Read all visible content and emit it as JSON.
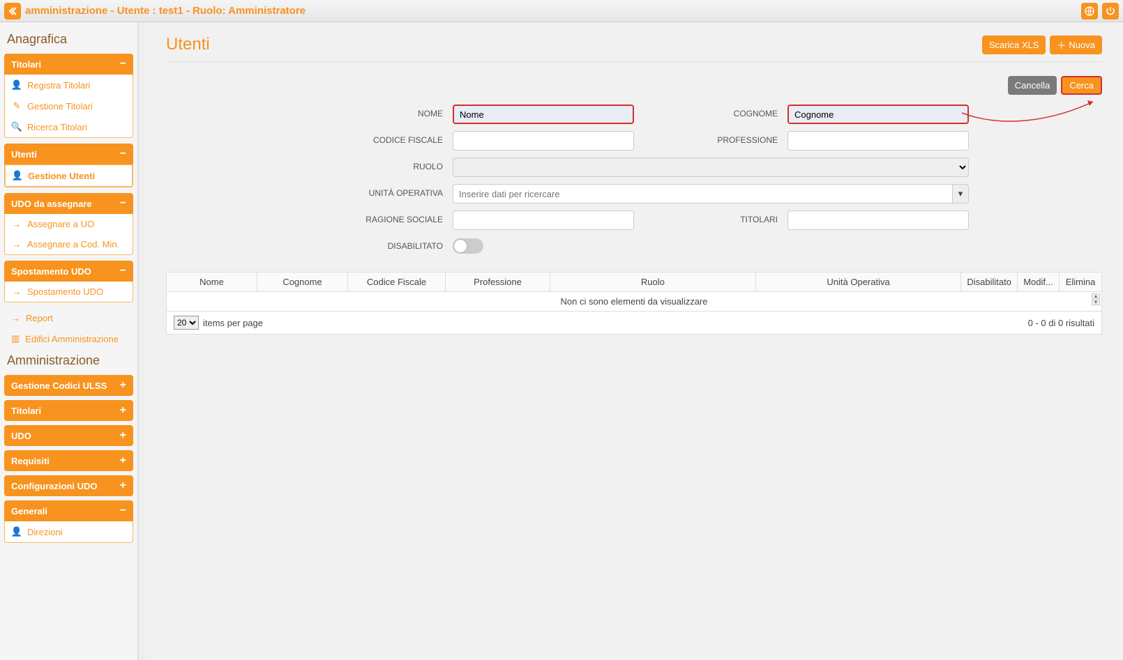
{
  "topbar": {
    "title": "amministrazione - Utente : test1 - Ruolo: Amministratore"
  },
  "sidebar": {
    "section1": "Anagrafica",
    "section2": "Amministrazione",
    "groups": {
      "titolari": {
        "label": "Titolari",
        "items": [
          "Registra Titolari",
          "Gestione Titolari",
          "Ricerca Titolari"
        ]
      },
      "utenti": {
        "label": "Utenti",
        "items": [
          "Gestione Utenti"
        ]
      },
      "udo_assegnare": {
        "label": "UDO da assegnare",
        "items": [
          "Assegnare a UO",
          "Assegnare a Cod. Min."
        ]
      },
      "spostamento": {
        "label": "Spostamento UDO",
        "items": [
          "Spostamento UDO"
        ]
      }
    },
    "links": {
      "report": "Report",
      "edifici": "Edifici Amministrazione"
    },
    "collapsed": {
      "ulss": "Gestione Codici ULSS",
      "titolari2": "Titolari",
      "udo": "UDO",
      "requisiti": "Requisiti",
      "config": "Configurazioni UDO",
      "generali": "Generali"
    },
    "generali_items": [
      "Direzioni"
    ]
  },
  "main": {
    "title": "Utenti",
    "buttons": {
      "xls": "Scarica XLS",
      "nuova": "Nuova",
      "cancella": "Cancella",
      "cerca": "Cerca"
    },
    "form": {
      "nome_label": "NOME",
      "nome_value": "Nome",
      "cognome_label": "COGNOME",
      "cognome_value": "Cognome",
      "cf_label": "CODICE FISCALE",
      "professione_label": "PROFESSIONE",
      "ruolo_label": "RUOLO",
      "unita_label": "UNITÀ OPERATIVA",
      "unita_placeholder": "Inserire dati per ricercare",
      "ragione_label": "RAGIONE SOCIALE",
      "titolari_label": "TITOLARI",
      "disabilitato_label": "DISABILITATO"
    },
    "table": {
      "headers": [
        "Nome",
        "Cognome",
        "Codice Fiscale",
        "Professione",
        "Ruolo",
        "Unità Operativa",
        "Disabilitato",
        "Modif...",
        "Elimina"
      ],
      "empty": "Non ci sono elementi da visualizzare",
      "pager_select": "20",
      "pager_text": "items per page",
      "pager_info": "0 - 0 di 0 risultati"
    }
  }
}
